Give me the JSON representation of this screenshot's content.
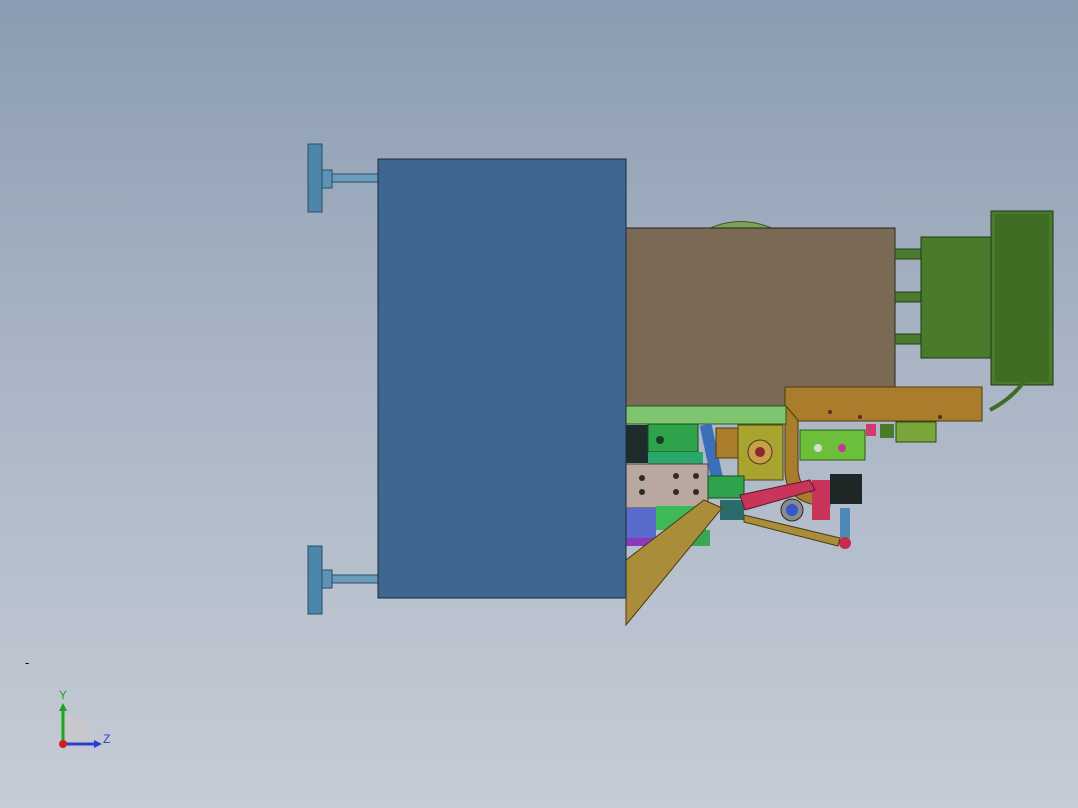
{
  "viewport": {
    "background_top": "#8b9cb2",
    "background_bottom": "#c6ccd6",
    "marker_text": "-"
  },
  "triad": {
    "y_label": "Y",
    "z_label": "Z",
    "y_color": "#1aa51a",
    "z_color": "#2a3fd1",
    "x_color": "#d11f1f"
  },
  "model": {
    "main_block_color": "#3d6690",
    "housing_color": "#7a6a55",
    "motor_color": "#4a7a2c",
    "bracket_color": "#a97d2c",
    "handle_color": "#4c86ab"
  }
}
